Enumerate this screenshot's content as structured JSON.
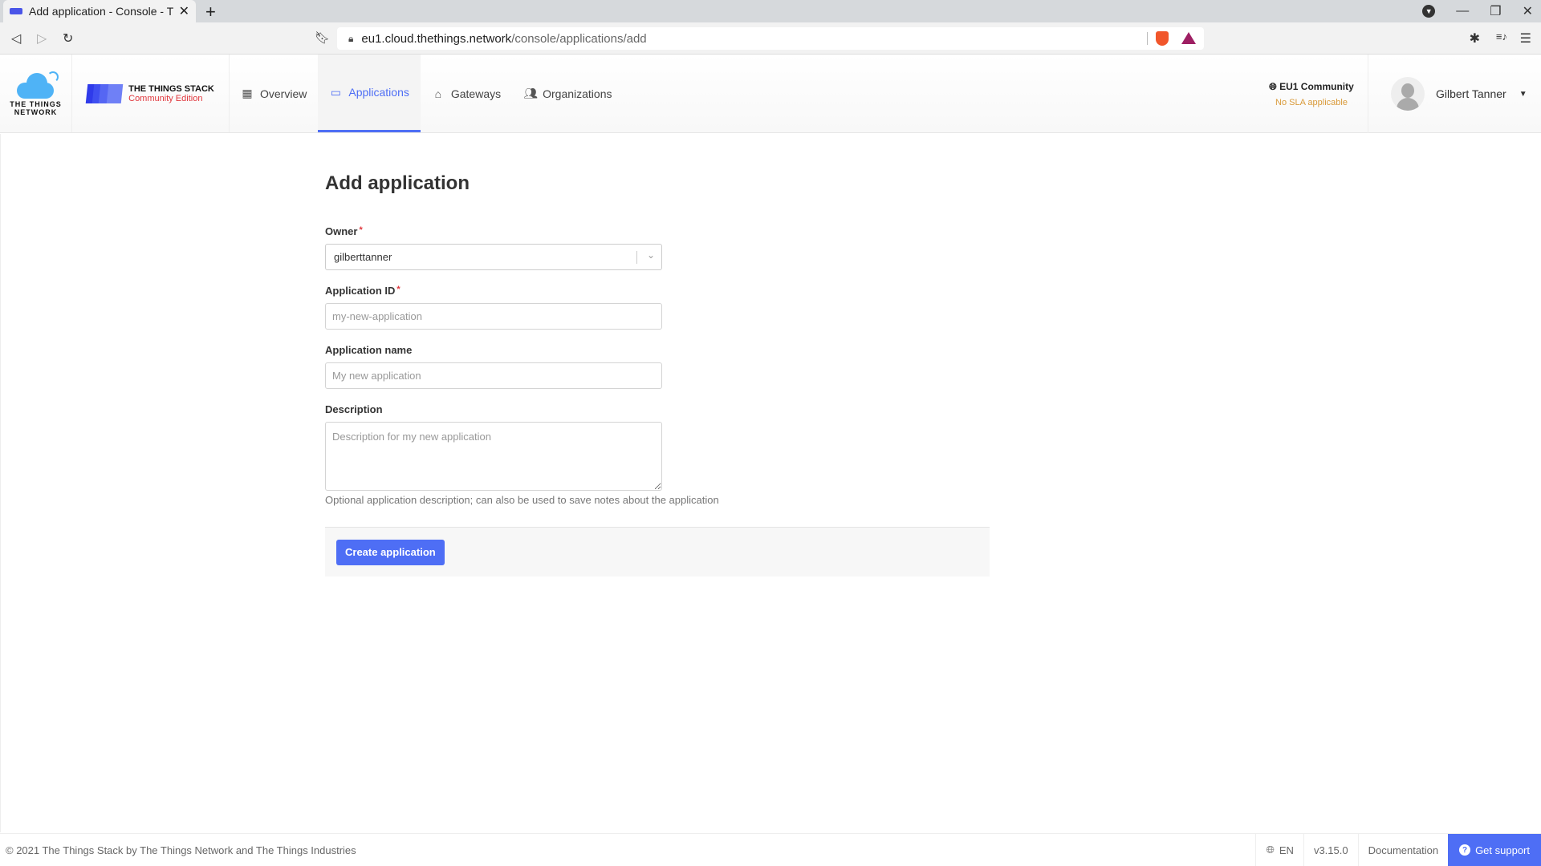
{
  "browser": {
    "tab_title": "Add application - Console - Th",
    "tab_close_glyph": "✕",
    "new_tab_glyph": "+",
    "url_host": "eu1.cloud.thethings.network",
    "url_path": "/console/applications/add",
    "icons": {
      "back": "◁",
      "forward": "▷",
      "reload": "↻",
      "bookmark": "🔖︎",
      "lock": "🔒︎",
      "extensions": "✱",
      "playlist": "≡♪",
      "menu": "☰",
      "dropdown": "▼",
      "minimize": "—",
      "restore": "❐",
      "close": "✕"
    }
  },
  "header": {
    "ttn_logo_line1": "THE THINGS",
    "ttn_logo_line2": "NETWORK",
    "tts_logo_line1": "THE THINGS STACK",
    "tts_logo_line2": "Community Edition",
    "nav": [
      {
        "label": "Overview",
        "icon": "▦",
        "active": false
      },
      {
        "label": "Applications",
        "icon": "▭",
        "active": true
      },
      {
        "label": "Gateways",
        "icon": "⌂",
        "active": false
      },
      {
        "label": "Organizations",
        "icon": "👥︎",
        "active": false
      }
    ],
    "cluster": {
      "icon": "🌐︎",
      "name": "EU1 Community",
      "sla": "No SLA applicable"
    },
    "user": {
      "name": "Gilbert Tanner",
      "caret": "▼"
    }
  },
  "form": {
    "title": "Add application",
    "owner": {
      "label": "Owner",
      "required": "*",
      "value": "gilberttanner",
      "chevron": "⌄"
    },
    "app_id": {
      "label": "Application ID",
      "required": "*",
      "value": "",
      "placeholder": "my-new-application"
    },
    "app_name": {
      "label": "Application name",
      "value": "",
      "placeholder": "My new application"
    },
    "description": {
      "label": "Description",
      "value": "",
      "placeholder": "Description for my new application",
      "hint": "Optional application description; can also be used to save notes about the application"
    },
    "submit_label": "Create application"
  },
  "footer": {
    "copyright": "© 2021 The Things Stack by The Things Network and The Things Industries",
    "language_icon": "🌐︎",
    "language": "EN",
    "version": "v3.15.0",
    "documentation": "Documentation",
    "support_icon": "?",
    "support": "Get support"
  },
  "colors": {
    "accent": "#4e6ef5",
    "required": "#e0363c",
    "sla_warning": "#d99a3a"
  }
}
